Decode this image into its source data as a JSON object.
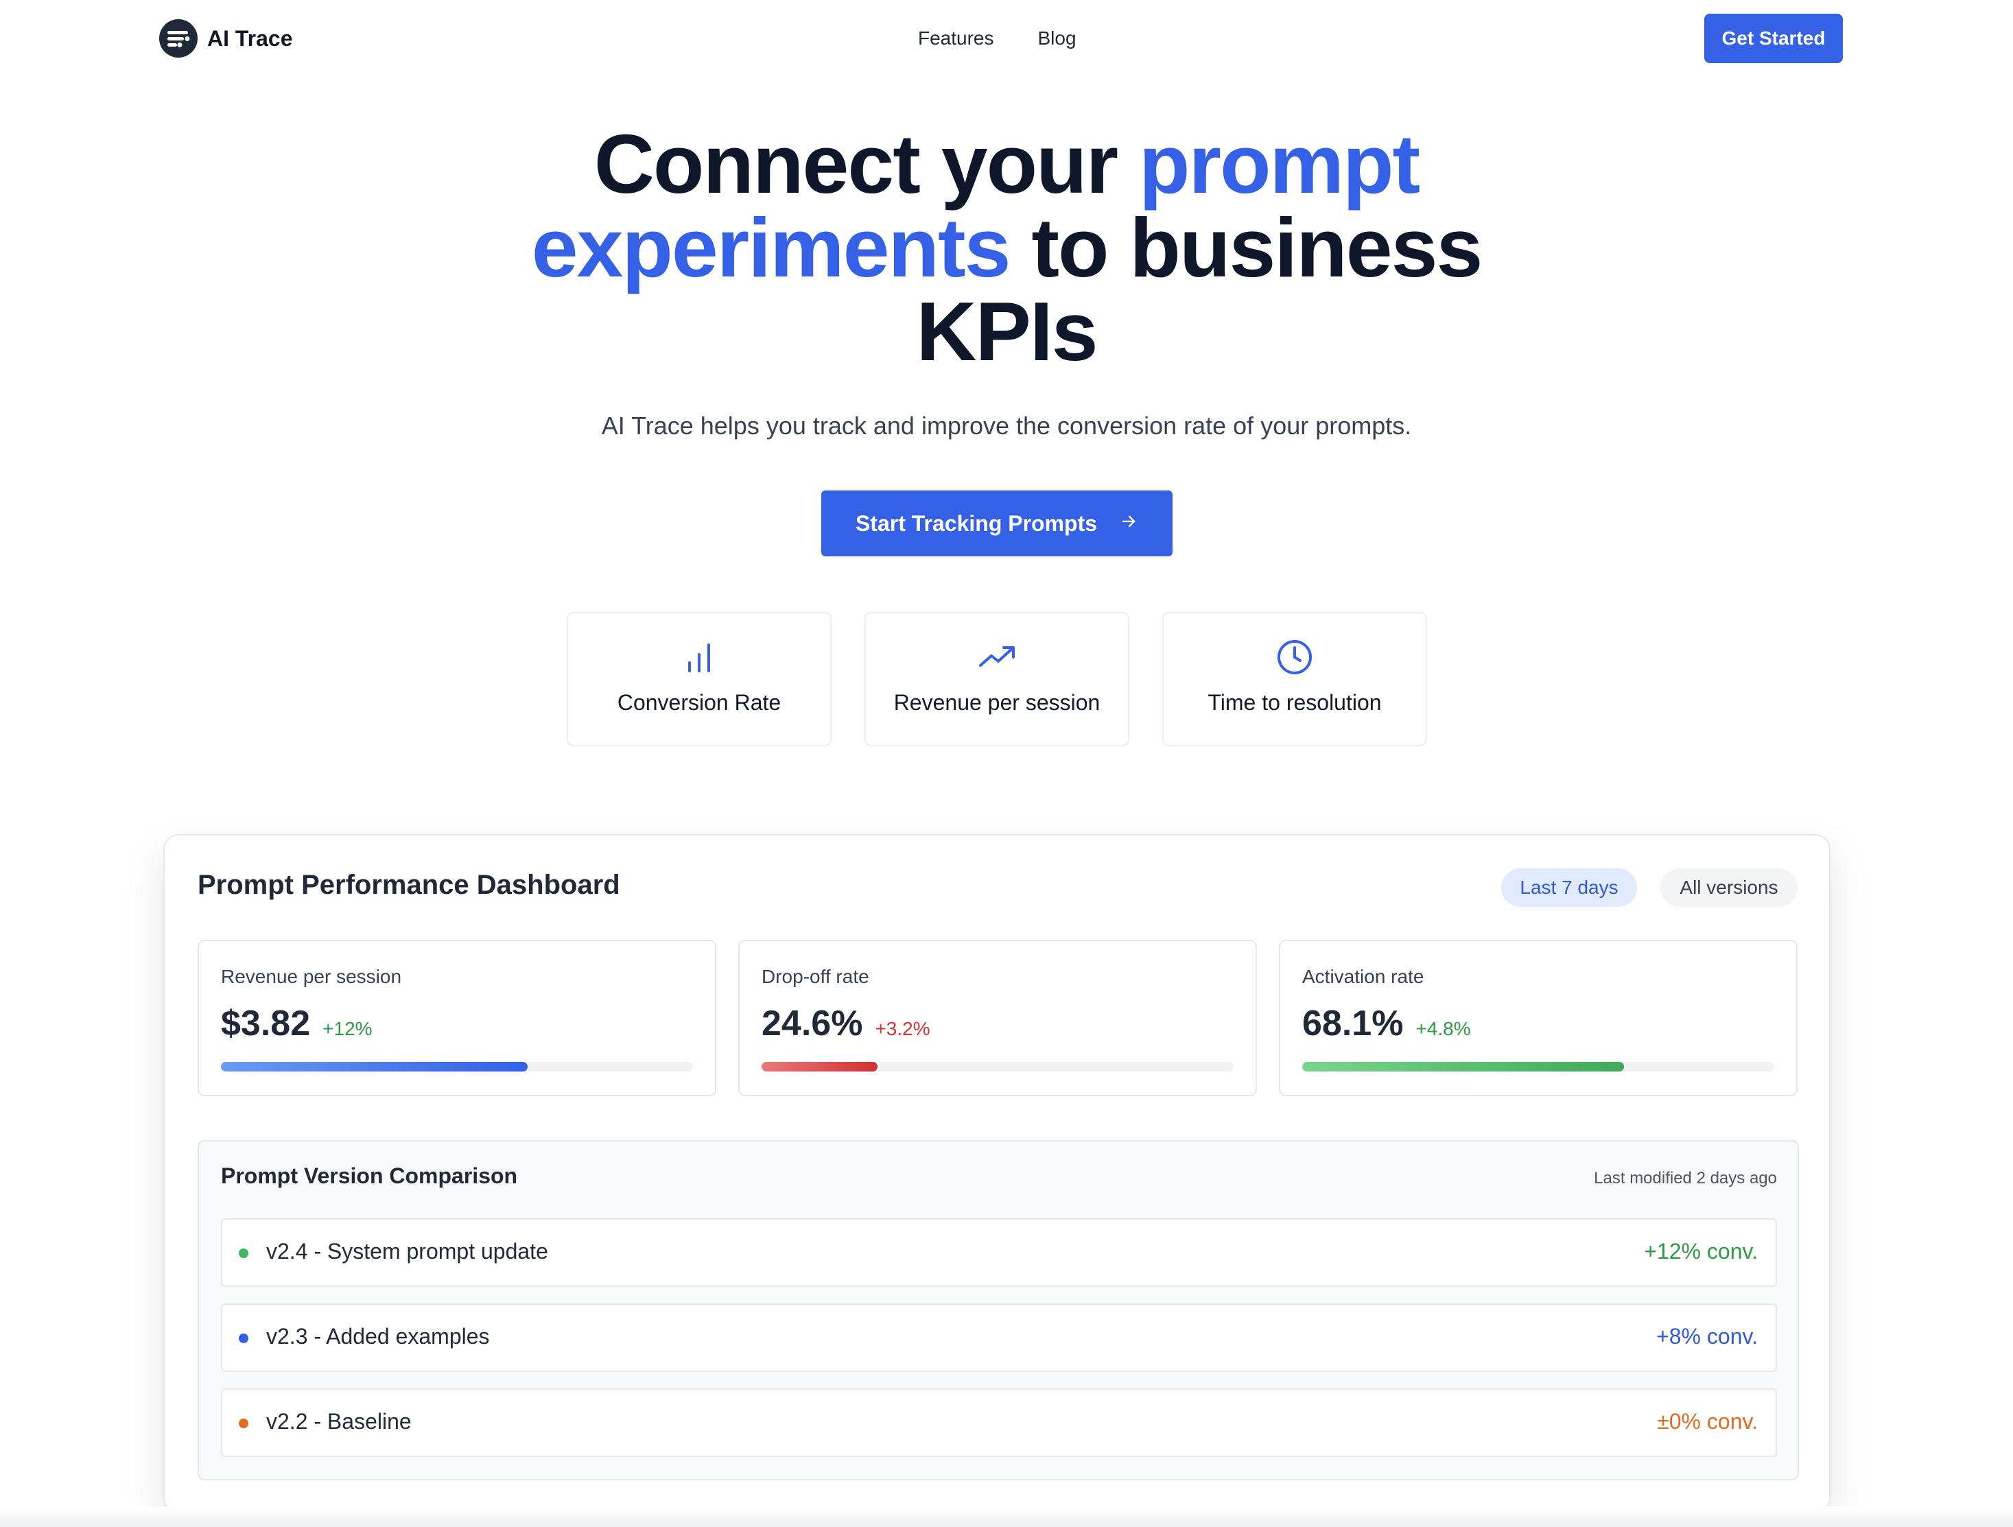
{
  "header": {
    "brand": "AI Trace",
    "nav": [
      {
        "label": "Features"
      },
      {
        "label": "Blog"
      }
    ],
    "cta_label": "Get Started"
  },
  "hero": {
    "title_line1_plain": "Connect your ",
    "title_line1_accent": "prompt",
    "title_line2_accent": "experiments",
    "title_line2_plain": " to business",
    "title_line3": "KPIs",
    "subtitle": "AI Trace helps you track and improve the conversion rate of your prompts.",
    "cta_label": "Start Tracking Prompts",
    "accent_color": "#3461e6"
  },
  "features": [
    {
      "label": "Conversion Rate",
      "icon": "bar-chart-icon"
    },
    {
      "label": "Revenue per session",
      "icon": "trending-up-icon"
    },
    {
      "label": "Time to resolution",
      "icon": "clock-icon"
    }
  ],
  "dashboard": {
    "title": "Prompt Performance Dashboard",
    "filter_range": "Last 7 days",
    "filter_versions": "All versions",
    "metrics": [
      {
        "label": "Revenue per session",
        "value": "$3.82",
        "delta": "+12%",
        "delta_color": "#2e9a43",
        "progress": 0.65,
        "bar_color": "#3461e6"
      },
      {
        "label": "Drop-off rate",
        "value": "24.6%",
        "delta": "+3.2%",
        "delta_color": "#d13232",
        "progress": 0.246,
        "bar_color": "#d13232"
      },
      {
        "label": "Activation rate",
        "value": "68.1%",
        "delta": "+4.8%",
        "delta_color": "#2e9a43",
        "progress": 0.681,
        "bar_color": "#43a85a"
      }
    ],
    "comparison": {
      "title": "Prompt Version Comparison",
      "last_modified": "Last modified 2 days ago",
      "versions": [
        {
          "name": "v2.4 - System prompt update",
          "conv": "+12% conv.",
          "color": "#2e9a43",
          "dot": "#3fb75a"
        },
        {
          "name": "v2.3 - Added examples",
          "conv": "+8% conv.",
          "color": "#2f5bd8",
          "dot": "#3461e6"
        },
        {
          "name": "v2.2 - Baseline",
          "conv": "±0% conv.",
          "color": "#e26a1c",
          "dot": "#e26a1c"
        }
      ]
    }
  }
}
